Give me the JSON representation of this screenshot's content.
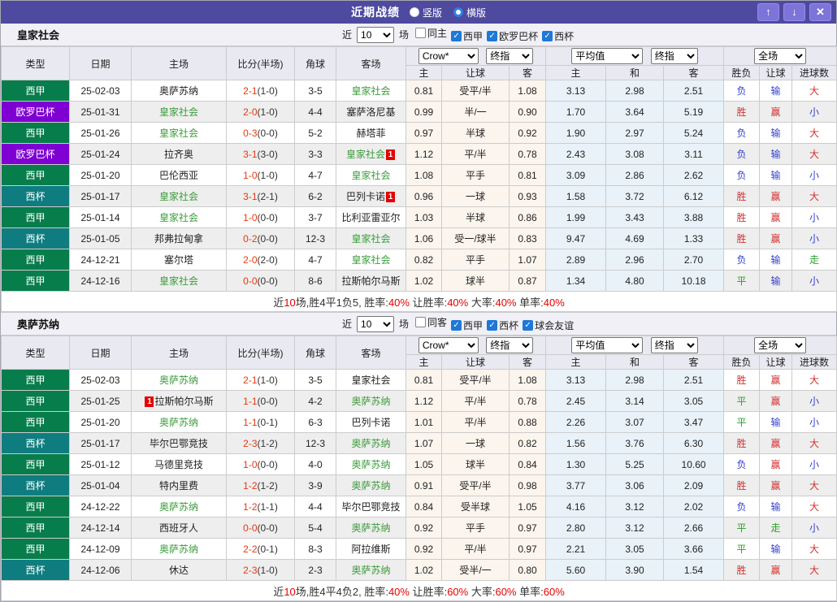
{
  "title_bar": {
    "title": "近期战绩",
    "radio_vertical": "竖版",
    "radio_horizontal": "横版",
    "up_icon": "↑",
    "down_icon": "↓",
    "close_icon": "✕"
  },
  "columns": {
    "type": "类型",
    "date": "日期",
    "home": "主场",
    "score": "比分(半场)",
    "corner": "角球",
    "away": "客场",
    "odds_home": "主",
    "odds_handicap": "让球",
    "odds_away": "客",
    "avg_home": "主",
    "avg_draw": "和",
    "avg_away": "客",
    "result_wdl": "胜负",
    "result_handicap": "让球",
    "result_goals": "进球数"
  },
  "league_colors": {
    "西甲": "#077d4c",
    "欧罗巴杯": "#7f00d2",
    "西杯": "#0f7d7f"
  },
  "sections": [
    {
      "team": "皇家社会",
      "filter": {
        "near": "近",
        "count": "10",
        "games": "场",
        "checks": [
          {
            "label": "同主",
            "checked": false
          },
          {
            "label": "西甲",
            "checked": true
          },
          {
            "label": "欧罗巴杯",
            "checked": true
          },
          {
            "label": "西杯",
            "checked": true
          }
        ]
      },
      "selects": {
        "odds_source": "Crow*",
        "odds_final": "终指",
        "avg": "平均值",
        "avg_final": "终指",
        "scope": "全场"
      },
      "rows": [
        {
          "type": "西甲",
          "date": "25-02-03",
          "home": "奥萨苏纳",
          "home_focus": false,
          "home_badge_pre": "",
          "home_badge": "",
          "score_ft": "2-1",
          "score_ht": "(1-0)",
          "corner": "3-5",
          "away": "皇家社会",
          "away_focus": true,
          "away_badge": "",
          "odds": [
            "0.81",
            "受平/半",
            "1.08"
          ],
          "avg": [
            "3.13",
            "2.98",
            "2.51"
          ],
          "results": [
            {
              "t": "负",
              "c": "b"
            },
            {
              "t": "输",
              "c": "b"
            },
            {
              "t": "大",
              "c": "r"
            }
          ]
        },
        {
          "type": "欧罗巴杯",
          "date": "25-01-31",
          "home": "皇家社会",
          "home_focus": true,
          "home_badge_pre": "",
          "home_badge": "",
          "score_ft": "2-0",
          "score_ht": "(1-0)",
          "corner": "4-4",
          "away": "塞萨洛尼基",
          "away_focus": false,
          "away_badge": "",
          "odds": [
            "0.99",
            "半/一",
            "0.90"
          ],
          "avg": [
            "1.70",
            "3.64",
            "5.19"
          ],
          "results": [
            {
              "t": "胜",
              "c": "r"
            },
            {
              "t": "赢",
              "c": "r"
            },
            {
              "t": "小",
              "c": "b"
            }
          ]
        },
        {
          "type": "西甲",
          "date": "25-01-26",
          "home": "皇家社会",
          "home_focus": true,
          "home_badge_pre": "",
          "home_badge": "",
          "score_ft": "0-3",
          "score_ht": "(0-0)",
          "corner": "5-2",
          "away": "赫塔菲",
          "away_focus": false,
          "away_badge": "",
          "odds": [
            "0.97",
            "半球",
            "0.92"
          ],
          "avg": [
            "1.90",
            "2.97",
            "5.24"
          ],
          "results": [
            {
              "t": "负",
              "c": "b"
            },
            {
              "t": "输",
              "c": "b"
            },
            {
              "t": "大",
              "c": "r"
            }
          ]
        },
        {
          "type": "欧罗巴杯",
          "date": "25-01-24",
          "home": "拉齐奥",
          "home_focus": false,
          "home_badge_pre": "",
          "home_badge": "",
          "score_ft": "3-1",
          "score_ht": "(3-0)",
          "corner": "3-3",
          "away": "皇家社会",
          "away_focus": true,
          "away_badge": "1",
          "odds": [
            "1.12",
            "平/半",
            "0.78"
          ],
          "avg": [
            "2.43",
            "3.08",
            "3.11"
          ],
          "results": [
            {
              "t": "负",
              "c": "b"
            },
            {
              "t": "输",
              "c": "b"
            },
            {
              "t": "大",
              "c": "r"
            }
          ]
        },
        {
          "type": "西甲",
          "date": "25-01-20",
          "home": "巴伦西亚",
          "home_focus": false,
          "home_badge_pre": "",
          "home_badge": "",
          "score_ft": "1-0",
          "score_ht": "(1-0)",
          "corner": "4-7",
          "away": "皇家社会",
          "away_focus": true,
          "away_badge": "",
          "odds": [
            "1.08",
            "平手",
            "0.81"
          ],
          "avg": [
            "3.09",
            "2.86",
            "2.62"
          ],
          "results": [
            {
              "t": "负",
              "c": "b"
            },
            {
              "t": "输",
              "c": "b"
            },
            {
              "t": "小",
              "c": "b"
            }
          ]
        },
        {
          "type": "西杯",
          "date": "25-01-17",
          "home": "皇家社会",
          "home_focus": true,
          "home_badge_pre": "",
          "home_badge": "",
          "score_ft": "3-1",
          "score_ht": "(2-1)",
          "corner": "6-2",
          "away": "巴列卡诺",
          "away_focus": false,
          "away_badge": "1",
          "odds": [
            "0.96",
            "一球",
            "0.93"
          ],
          "avg": [
            "1.58",
            "3.72",
            "6.12"
          ],
          "results": [
            {
              "t": "胜",
              "c": "r"
            },
            {
              "t": "赢",
              "c": "r"
            },
            {
              "t": "大",
              "c": "r"
            }
          ]
        },
        {
          "type": "西甲",
          "date": "25-01-14",
          "home": "皇家社会",
          "home_focus": true,
          "home_badge_pre": "",
          "home_badge": "",
          "score_ft": "1-0",
          "score_ht": "(0-0)",
          "corner": "3-7",
          "away": "比利亚雷亚尔",
          "away_focus": false,
          "away_badge": "",
          "odds": [
            "1.03",
            "半球",
            "0.86"
          ],
          "avg": [
            "1.99",
            "3.43",
            "3.88"
          ],
          "results": [
            {
              "t": "胜",
              "c": "r"
            },
            {
              "t": "赢",
              "c": "r"
            },
            {
              "t": "小",
              "c": "b"
            }
          ]
        },
        {
          "type": "西杯",
          "date": "25-01-05",
          "home": "邦弗拉甸拿",
          "home_focus": false,
          "home_badge_pre": "",
          "home_badge": "",
          "score_ft": "0-2",
          "score_ht": "(0-0)",
          "corner": "12-3",
          "away": "皇家社会",
          "away_focus": true,
          "away_badge": "",
          "odds": [
            "1.06",
            "受一/球半",
            "0.83"
          ],
          "avg": [
            "9.47",
            "4.69",
            "1.33"
          ],
          "results": [
            {
              "t": "胜",
              "c": "r"
            },
            {
              "t": "赢",
              "c": "r"
            },
            {
              "t": "小",
              "c": "b"
            }
          ]
        },
        {
          "type": "西甲",
          "date": "24-12-21",
          "home": "塞尔塔",
          "home_focus": false,
          "home_badge_pre": "",
          "home_badge": "",
          "score_ft": "2-0",
          "score_ht": "(2-0)",
          "corner": "4-7",
          "away": "皇家社会",
          "away_focus": true,
          "away_badge": "",
          "odds": [
            "0.82",
            "平手",
            "1.07"
          ],
          "avg": [
            "2.89",
            "2.96",
            "2.70"
          ],
          "results": [
            {
              "t": "负",
              "c": "b"
            },
            {
              "t": "输",
              "c": "b"
            },
            {
              "t": "走",
              "c": "g"
            }
          ]
        },
        {
          "type": "西甲",
          "date": "24-12-16",
          "home": "皇家社会",
          "home_focus": true,
          "home_badge_pre": "",
          "home_badge": "",
          "score_ft": "0-0",
          "score_ht": "(0-0)",
          "corner": "8-6",
          "away": "拉斯帕尔马斯",
          "away_focus": false,
          "away_badge": "",
          "odds": [
            "1.02",
            "球半",
            "0.87"
          ],
          "avg": [
            "1.34",
            "4.80",
            "10.18"
          ],
          "results": [
            {
              "t": "平",
              "c": "g"
            },
            {
              "t": "输",
              "c": "b"
            },
            {
              "t": "小",
              "c": "b"
            }
          ]
        }
      ],
      "summary": [
        {
          "t": "近",
          "c": "k"
        },
        {
          "t": "10",
          "c": "r"
        },
        {
          "t": "场,胜4平1负5, 胜率:",
          "c": "k"
        },
        {
          "t": "40%",
          "c": "r"
        },
        {
          "t": " 让胜率:",
          "c": "k"
        },
        {
          "t": "40%",
          "c": "r"
        },
        {
          "t": " 大率:",
          "c": "k"
        },
        {
          "t": "40%",
          "c": "r"
        },
        {
          "t": " 单率:",
          "c": "k"
        },
        {
          "t": "40%",
          "c": "r"
        }
      ]
    },
    {
      "team": "奥萨苏纳",
      "filter": {
        "near": "近",
        "count": "10",
        "games": "场",
        "checks": [
          {
            "label": "同客",
            "checked": false
          },
          {
            "label": "西甲",
            "checked": true
          },
          {
            "label": "西杯",
            "checked": true
          },
          {
            "label": "球会友谊",
            "checked": true
          }
        ]
      },
      "selects": {
        "odds_source": "Crow*",
        "odds_final": "终指",
        "avg": "平均值",
        "avg_final": "终指",
        "scope": "全场"
      },
      "rows": [
        {
          "type": "西甲",
          "date": "25-02-03",
          "home": "奥萨苏纳",
          "home_focus": true,
          "home_badge_pre": "",
          "home_badge": "",
          "score_ft": "2-1",
          "score_ht": "(1-0)",
          "corner": "3-5",
          "away": "皇家社会",
          "away_focus": false,
          "away_badge": "",
          "odds": [
            "0.81",
            "受平/半",
            "1.08"
          ],
          "avg": [
            "3.13",
            "2.98",
            "2.51"
          ],
          "results": [
            {
              "t": "胜",
              "c": "r"
            },
            {
              "t": "赢",
              "c": "r"
            },
            {
              "t": "大",
              "c": "r"
            }
          ]
        },
        {
          "type": "西甲",
          "date": "25-01-25",
          "home": "拉斯帕尔马斯",
          "home_focus": false,
          "home_badge_pre": "1",
          "home_badge": "",
          "score_ft": "1-1",
          "score_ht": "(0-0)",
          "corner": "4-2",
          "away": "奥萨苏纳",
          "away_focus": true,
          "away_badge": "",
          "odds": [
            "1.12",
            "平/半",
            "0.78"
          ],
          "avg": [
            "2.45",
            "3.14",
            "3.05"
          ],
          "results": [
            {
              "t": "平",
              "c": "g"
            },
            {
              "t": "赢",
              "c": "r"
            },
            {
              "t": "小",
              "c": "b"
            }
          ]
        },
        {
          "type": "西甲",
          "date": "25-01-20",
          "home": "奥萨苏纳",
          "home_focus": true,
          "home_badge_pre": "",
          "home_badge": "",
          "score_ft": "1-1",
          "score_ht": "(0-1)",
          "corner": "6-3",
          "away": "巴列卡诺",
          "away_focus": false,
          "away_badge": "",
          "odds": [
            "1.01",
            "平/半",
            "0.88"
          ],
          "avg": [
            "2.26",
            "3.07",
            "3.47"
          ],
          "results": [
            {
              "t": "平",
              "c": "g"
            },
            {
              "t": "输",
              "c": "b"
            },
            {
              "t": "小",
              "c": "b"
            }
          ]
        },
        {
          "type": "西杯",
          "date": "25-01-17",
          "home": "毕尔巴鄂竞技",
          "home_focus": false,
          "home_badge_pre": "",
          "home_badge": "",
          "score_ft": "2-3",
          "score_ht": "(1-2)",
          "corner": "12-3",
          "away": "奥萨苏纳",
          "away_focus": true,
          "away_badge": "",
          "odds": [
            "1.07",
            "一球",
            "0.82"
          ],
          "avg": [
            "1.56",
            "3.76",
            "6.30"
          ],
          "results": [
            {
              "t": "胜",
              "c": "r"
            },
            {
              "t": "赢",
              "c": "r"
            },
            {
              "t": "大",
              "c": "r"
            }
          ]
        },
        {
          "type": "西甲",
          "date": "25-01-12",
          "home": "马德里竞技",
          "home_focus": false,
          "home_badge_pre": "",
          "home_badge": "",
          "score_ft": "1-0",
          "score_ht": "(0-0)",
          "corner": "4-0",
          "away": "奥萨苏纳",
          "away_focus": true,
          "away_badge": "",
          "odds": [
            "1.05",
            "球半",
            "0.84"
          ],
          "avg": [
            "1.30",
            "5.25",
            "10.60"
          ],
          "results": [
            {
              "t": "负",
              "c": "b"
            },
            {
              "t": "赢",
              "c": "r"
            },
            {
              "t": "小",
              "c": "b"
            }
          ]
        },
        {
          "type": "西杯",
          "date": "25-01-04",
          "home": "特内里费",
          "home_focus": false,
          "home_badge_pre": "",
          "home_badge": "",
          "score_ft": "1-2",
          "score_ht": "(1-2)",
          "corner": "3-9",
          "away": "奥萨苏纳",
          "away_focus": true,
          "away_badge": "",
          "odds": [
            "0.91",
            "受平/半",
            "0.98"
          ],
          "avg": [
            "3.77",
            "3.06",
            "2.09"
          ],
          "results": [
            {
              "t": "胜",
              "c": "r"
            },
            {
              "t": "赢",
              "c": "r"
            },
            {
              "t": "大",
              "c": "r"
            }
          ]
        },
        {
          "type": "西甲",
          "date": "24-12-22",
          "home": "奥萨苏纳",
          "home_focus": true,
          "home_badge_pre": "",
          "home_badge": "",
          "score_ft": "1-2",
          "score_ht": "(1-1)",
          "corner": "4-4",
          "away": "毕尔巴鄂竞技",
          "away_focus": false,
          "away_badge": "",
          "odds": [
            "0.84",
            "受半球",
            "1.05"
          ],
          "avg": [
            "4.16",
            "3.12",
            "2.02"
          ],
          "results": [
            {
              "t": "负",
              "c": "b"
            },
            {
              "t": "输",
              "c": "b"
            },
            {
              "t": "大",
              "c": "r"
            }
          ]
        },
        {
          "type": "西甲",
          "date": "24-12-14",
          "home": "西班牙人",
          "home_focus": false,
          "home_badge_pre": "",
          "home_badge": "",
          "score_ft": "0-0",
          "score_ht": "(0-0)",
          "corner": "5-4",
          "away": "奥萨苏纳",
          "away_focus": true,
          "away_badge": "",
          "odds": [
            "0.92",
            "平手",
            "0.97"
          ],
          "avg": [
            "2.80",
            "3.12",
            "2.66"
          ],
          "results": [
            {
              "t": "平",
              "c": "g"
            },
            {
              "t": "走",
              "c": "g"
            },
            {
              "t": "小",
              "c": "b"
            }
          ]
        },
        {
          "type": "西甲",
          "date": "24-12-09",
          "home": "奥萨苏纳",
          "home_focus": true,
          "home_badge_pre": "",
          "home_badge": "",
          "score_ft": "2-2",
          "score_ht": "(0-1)",
          "corner": "8-3",
          "away": "阿拉维斯",
          "away_focus": false,
          "away_badge": "",
          "odds": [
            "0.92",
            "平/半",
            "0.97"
          ],
          "avg": [
            "2.21",
            "3.05",
            "3.66"
          ],
          "results": [
            {
              "t": "平",
              "c": "g"
            },
            {
              "t": "输",
              "c": "b"
            },
            {
              "t": "大",
              "c": "r"
            }
          ]
        },
        {
          "type": "西杯",
          "date": "24-12-06",
          "home": "休达",
          "home_focus": false,
          "home_badge_pre": "",
          "home_badge": "",
          "score_ft": "2-3",
          "score_ht": "(1-0)",
          "corner": "2-3",
          "away": "奥萨苏纳",
          "away_focus": true,
          "away_badge": "",
          "odds": [
            "1.02",
            "受半/一",
            "0.80"
          ],
          "avg": [
            "5.60",
            "3.90",
            "1.54"
          ],
          "results": [
            {
              "t": "胜",
              "c": "r"
            },
            {
              "t": "赢",
              "c": "r"
            },
            {
              "t": "大",
              "c": "r"
            }
          ]
        }
      ],
      "summary": [
        {
          "t": "近",
          "c": "k"
        },
        {
          "t": "10",
          "c": "r"
        },
        {
          "t": "场,胜4平4负2, 胜率:",
          "c": "k"
        },
        {
          "t": "40%",
          "c": "r"
        },
        {
          "t": " 让胜率:",
          "c": "k"
        },
        {
          "t": "60%",
          "c": "r"
        },
        {
          "t": " 大率:",
          "c": "k"
        },
        {
          "t": "60%",
          "c": "r"
        },
        {
          "t": " 单率:",
          "c": "k"
        },
        {
          "t": "60%",
          "c": "r"
        }
      ]
    }
  ]
}
